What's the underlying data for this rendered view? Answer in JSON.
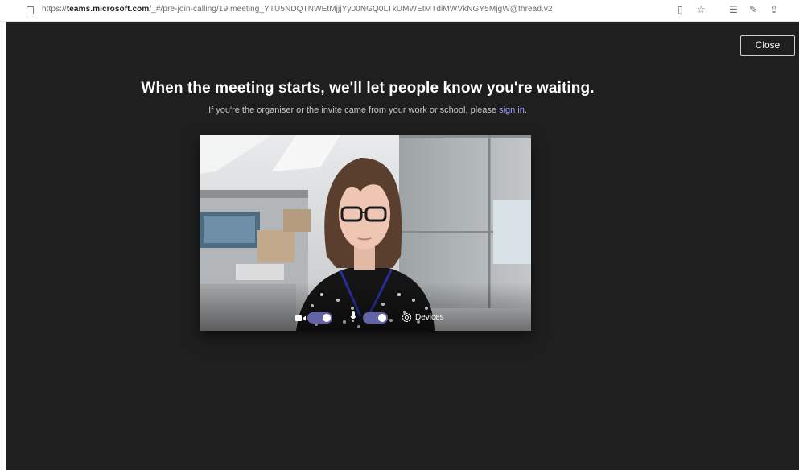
{
  "browser": {
    "url_prefix": "https://",
    "url_host": "teams.microsoft.com",
    "url_path": "/_#/pre-join-calling/19:meeting_YTU5NDQTNWEtMjjjYy00NGQ0LTkUMWEtMTdiMWVkNGY5MjgW@thread.v2"
  },
  "dialog": {
    "close_label": "Close",
    "title": "When the meeting starts, we'll let people know you're waiting.",
    "subtitle_prefix": "If you're the organiser or the invite came from your work or school, please ",
    "sign_in_label": "sign in",
    "subtitle_suffix": "."
  },
  "preview": {
    "camera_on": true,
    "mic_on": true,
    "devices_label": "Devices"
  },
  "colors": {
    "stage_background": "#1f1f1f",
    "accent": "#6264a7",
    "link": "#9ea2ff"
  },
  "icons": {
    "camera": "camera-icon",
    "microphone": "microphone-icon",
    "devices": "gear-icon"
  }
}
